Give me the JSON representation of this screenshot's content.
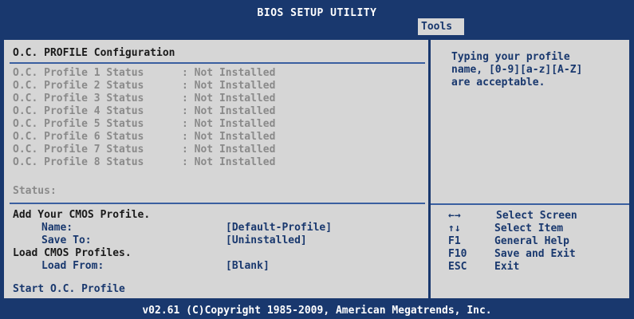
{
  "header": {
    "title": "BIOS SETUP UTILITY",
    "active_tab": "Tools"
  },
  "section": {
    "title": "O.C. PROFILE Configuration"
  },
  "profiles": [
    {
      "label": "O.C. Profile 1 Status",
      "value": ": Not Installed"
    },
    {
      "label": "O.C. Profile 2 Status",
      "value": ": Not Installed"
    },
    {
      "label": "O.C. Profile 3 Status",
      "value": ": Not Installed"
    },
    {
      "label": "O.C. Profile 4 Status",
      "value": ": Not Installed"
    },
    {
      "label": "O.C. Profile 5 Status",
      "value": ": Not Installed"
    },
    {
      "label": "O.C. Profile 6 Status",
      "value": ": Not Installed"
    },
    {
      "label": "O.C. Profile 7 Status",
      "value": ": Not Installed"
    },
    {
      "label": "O.C. Profile 8 Status",
      "value": ": Not Installed"
    }
  ],
  "status": {
    "label": "Status:"
  },
  "add_profile": {
    "heading": "Add Your CMOS Profile.",
    "name_label": "Name:",
    "name_value": "[Default-Profile]",
    "save_label": "Save To:",
    "save_value": "[Uninstalled]"
  },
  "load_profile": {
    "heading": "Load CMOS Profiles.",
    "load_label": "Load From:",
    "load_value": "[Blank]"
  },
  "start": {
    "label": "Start O.C. Profile"
  },
  "help": {
    "lines": [
      "Typing your profile",
      "name, [0-9][a-z][A-Z]",
      "are acceptable."
    ]
  },
  "keys": [
    {
      "key": "←→",
      "desc": "Select Screen"
    },
    {
      "key": "↑↓",
      "desc": "Select Item"
    },
    {
      "key": "F1",
      "desc": "General Help"
    },
    {
      "key": "F10",
      "desc": "Save and Exit"
    },
    {
      "key": "ESC",
      "desc": "Exit"
    }
  ],
  "footer": {
    "text": "v02.61 (C)Copyright 1985-2009, American Megatrends, Inc."
  }
}
